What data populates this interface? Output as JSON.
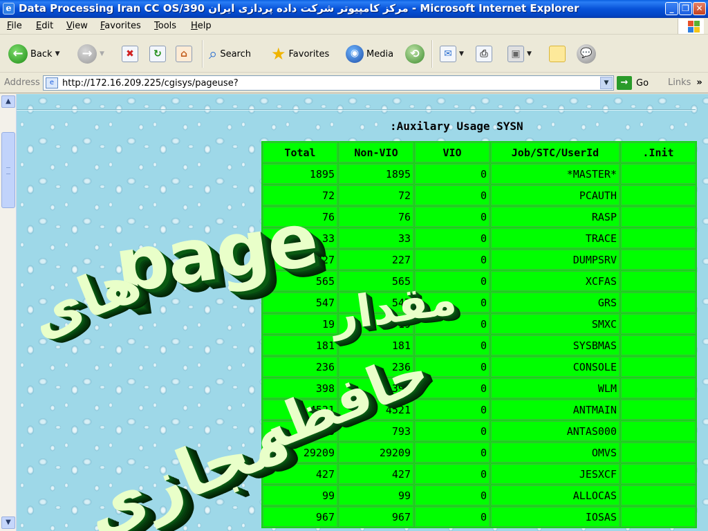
{
  "window": {
    "title": "Data Processing Iran CC OS/390 مرکز کامپیوتر شرکت داده پردازی ایران - Microsoft Internet Explorer",
    "app_icon": "e",
    "controls": {
      "minimize": "_",
      "maximize": "❐",
      "close": "✕"
    }
  },
  "menu": {
    "items": [
      "File",
      "Edit",
      "View",
      "Favorites",
      "Tools",
      "Help"
    ]
  },
  "toolbar": {
    "back_label": "Back",
    "search_label": "Search",
    "favorites_label": "Favorites",
    "media_label": "Media"
  },
  "address": {
    "label": "Address",
    "url": "http://172.16.209.225/cgisys/pageuse?",
    "go_label": "Go",
    "links_label": "Links",
    "links_chevron": "»"
  },
  "report": {
    "title": ":Auxilary Usage SYSN",
    "columns": [
      "Total",
      "Non-VIO",
      "VIO",
      "Job/STC/UserId",
      ".Init"
    ],
    "rows": [
      {
        "total": "1895",
        "nonvio": "1895",
        "vio": "0",
        "job": "*MASTER*",
        "init": ""
      },
      {
        "total": "72",
        "nonvio": "72",
        "vio": "0",
        "job": "PCAUTH",
        "init": ""
      },
      {
        "total": "76",
        "nonvio": "76",
        "vio": "0",
        "job": "RASP",
        "init": ""
      },
      {
        "total": "33",
        "nonvio": "33",
        "vio": "0",
        "job": "TRACE",
        "init": ""
      },
      {
        "total": "227",
        "nonvio": "227",
        "vio": "0",
        "job": "DUMPSRV",
        "init": ""
      },
      {
        "total": "565",
        "nonvio": "565",
        "vio": "0",
        "job": "XCFAS",
        "init": ""
      },
      {
        "total": "547",
        "nonvio": "547",
        "vio": "0",
        "job": "GRS",
        "init": ""
      },
      {
        "total": "19",
        "nonvio": "19",
        "vio": "0",
        "job": "SMXC",
        "init": ""
      },
      {
        "total": "181",
        "nonvio": "181",
        "vio": "0",
        "job": "SYSBMAS",
        "init": ""
      },
      {
        "total": "236",
        "nonvio": "236",
        "vio": "0",
        "job": "CONSOLE",
        "init": ""
      },
      {
        "total": "398",
        "nonvio": "398",
        "vio": "0",
        "job": "WLM",
        "init": ""
      },
      {
        "total": "4521",
        "nonvio": "4521",
        "vio": "0",
        "job": "ANTMAIN",
        "init": ""
      },
      {
        "total": "793",
        "nonvio": "793",
        "vio": "0",
        "job": "ANTAS000",
        "init": ""
      },
      {
        "total": "29209",
        "nonvio": "29209",
        "vio": "0",
        "job": "OMVS",
        "init": ""
      },
      {
        "total": "427",
        "nonvio": "427",
        "vio": "0",
        "job": "JESXCF",
        "init": ""
      },
      {
        "total": "99",
        "nonvio": "99",
        "vio": "0",
        "job": "ALLOCAS",
        "init": ""
      },
      {
        "total": "967",
        "nonvio": "967",
        "vio": "0",
        "job": "IOSAS",
        "init": ""
      }
    ]
  },
  "overlay": {
    "word_page": "page",
    "word_haye": "های",
    "word_miqdar": "مقدار",
    "word_hafeze": "حافظه",
    "word_majazi": "مجازی"
  },
  "colors": {
    "table_green": "#00ff00",
    "titlebar_blue": "#0752d8",
    "overlay_green": "#0a5a12"
  }
}
